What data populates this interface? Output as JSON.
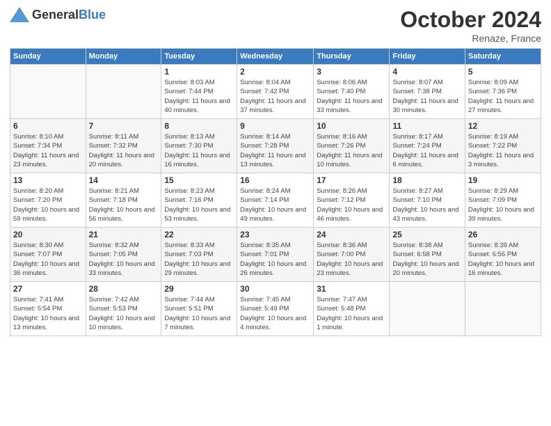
{
  "header": {
    "logo_general": "General",
    "logo_blue": "Blue",
    "month_title": "October 2024",
    "subtitle": "Renaze, France"
  },
  "days_of_week": [
    "Sunday",
    "Monday",
    "Tuesday",
    "Wednesday",
    "Thursday",
    "Friday",
    "Saturday"
  ],
  "weeks": [
    [
      {
        "day": "",
        "info": ""
      },
      {
        "day": "",
        "info": ""
      },
      {
        "day": "1",
        "info": "Sunrise: 8:03 AM\nSunset: 7:44 PM\nDaylight: 11 hours and 40 minutes."
      },
      {
        "day": "2",
        "info": "Sunrise: 8:04 AM\nSunset: 7:42 PM\nDaylight: 11 hours and 37 minutes."
      },
      {
        "day": "3",
        "info": "Sunrise: 8:06 AM\nSunset: 7:40 PM\nDaylight: 11 hours and 33 minutes."
      },
      {
        "day": "4",
        "info": "Sunrise: 8:07 AM\nSunset: 7:38 PM\nDaylight: 11 hours and 30 minutes."
      },
      {
        "day": "5",
        "info": "Sunrise: 8:09 AM\nSunset: 7:36 PM\nDaylight: 11 hours and 27 minutes."
      }
    ],
    [
      {
        "day": "6",
        "info": "Sunrise: 8:10 AM\nSunset: 7:34 PM\nDaylight: 11 hours and 23 minutes."
      },
      {
        "day": "7",
        "info": "Sunrise: 8:11 AM\nSunset: 7:32 PM\nDaylight: 11 hours and 20 minutes."
      },
      {
        "day": "8",
        "info": "Sunrise: 8:13 AM\nSunset: 7:30 PM\nDaylight: 11 hours and 16 minutes."
      },
      {
        "day": "9",
        "info": "Sunrise: 8:14 AM\nSunset: 7:28 PM\nDaylight: 11 hours and 13 minutes."
      },
      {
        "day": "10",
        "info": "Sunrise: 8:16 AM\nSunset: 7:26 PM\nDaylight: 11 hours and 10 minutes."
      },
      {
        "day": "11",
        "info": "Sunrise: 8:17 AM\nSunset: 7:24 PM\nDaylight: 11 hours and 6 minutes."
      },
      {
        "day": "12",
        "info": "Sunrise: 8:19 AM\nSunset: 7:22 PM\nDaylight: 11 hours and 3 minutes."
      }
    ],
    [
      {
        "day": "13",
        "info": "Sunrise: 8:20 AM\nSunset: 7:20 PM\nDaylight: 10 hours and 59 minutes."
      },
      {
        "day": "14",
        "info": "Sunrise: 8:21 AM\nSunset: 7:18 PM\nDaylight: 10 hours and 56 minutes."
      },
      {
        "day": "15",
        "info": "Sunrise: 8:23 AM\nSunset: 7:16 PM\nDaylight: 10 hours and 53 minutes."
      },
      {
        "day": "16",
        "info": "Sunrise: 8:24 AM\nSunset: 7:14 PM\nDaylight: 10 hours and 49 minutes."
      },
      {
        "day": "17",
        "info": "Sunrise: 8:26 AM\nSunset: 7:12 PM\nDaylight: 10 hours and 46 minutes."
      },
      {
        "day": "18",
        "info": "Sunrise: 8:27 AM\nSunset: 7:10 PM\nDaylight: 10 hours and 43 minutes."
      },
      {
        "day": "19",
        "info": "Sunrise: 8:29 AM\nSunset: 7:09 PM\nDaylight: 10 hours and 39 minutes."
      }
    ],
    [
      {
        "day": "20",
        "info": "Sunrise: 8:30 AM\nSunset: 7:07 PM\nDaylight: 10 hours and 36 minutes."
      },
      {
        "day": "21",
        "info": "Sunrise: 8:32 AM\nSunset: 7:05 PM\nDaylight: 10 hours and 33 minutes."
      },
      {
        "day": "22",
        "info": "Sunrise: 8:33 AM\nSunset: 7:03 PM\nDaylight: 10 hours and 29 minutes."
      },
      {
        "day": "23",
        "info": "Sunrise: 8:35 AM\nSunset: 7:01 PM\nDaylight: 10 hours and 26 minutes."
      },
      {
        "day": "24",
        "info": "Sunrise: 8:36 AM\nSunset: 7:00 PM\nDaylight: 10 hours and 23 minutes."
      },
      {
        "day": "25",
        "info": "Sunrise: 8:38 AM\nSunset: 6:58 PM\nDaylight: 10 hours and 20 minutes."
      },
      {
        "day": "26",
        "info": "Sunrise: 8:39 AM\nSunset: 6:56 PM\nDaylight: 10 hours and 16 minutes."
      }
    ],
    [
      {
        "day": "27",
        "info": "Sunrise: 7:41 AM\nSunset: 5:54 PM\nDaylight: 10 hours and 13 minutes."
      },
      {
        "day": "28",
        "info": "Sunrise: 7:42 AM\nSunset: 5:53 PM\nDaylight: 10 hours and 10 minutes."
      },
      {
        "day": "29",
        "info": "Sunrise: 7:44 AM\nSunset: 5:51 PM\nDaylight: 10 hours and 7 minutes."
      },
      {
        "day": "30",
        "info": "Sunrise: 7:45 AM\nSunset: 5:49 PM\nDaylight: 10 hours and 4 minutes."
      },
      {
        "day": "31",
        "info": "Sunrise: 7:47 AM\nSunset: 5:48 PM\nDaylight: 10 hours and 1 minute."
      },
      {
        "day": "",
        "info": ""
      },
      {
        "day": "",
        "info": ""
      }
    ]
  ]
}
